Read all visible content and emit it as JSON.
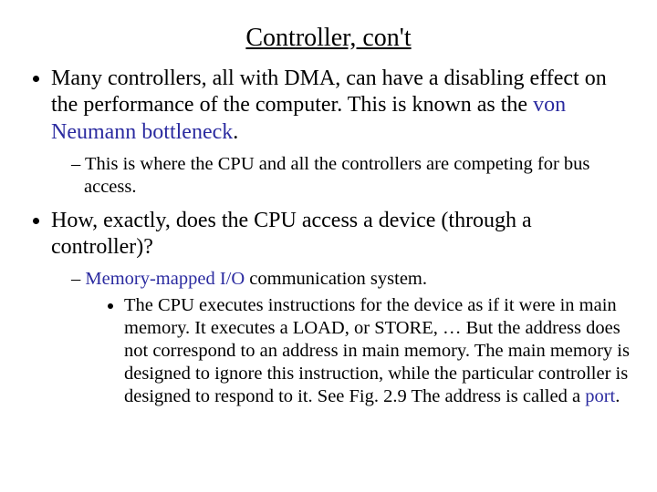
{
  "title": "Controller, con't",
  "p1a": "Many controllers, all with DMA, can have a disabling effect on the performance of the computer.  This is known as the ",
  "term1": "von Neumann bottleneck",
  "p1b": ".",
  "s1": "This is where the CPU and all the controllers are competing for bus access.",
  "p2": "How, exactly, does the CPU access a device (through a controller)?",
  "term2": "Memory-mapped I/O",
  "s2a": " communication system.",
  "s3a": "The CPU executes instructions for the device as if it were in main memory.  It executes a LOAD, or STORE, … But the address does not correspond to an address in main memory.  The main memory is designed to ignore this instruction, while the particular controller is designed to respond to it.  See Fig. 2.9  The address is called a ",
  "term3": "port",
  "s3b": "."
}
